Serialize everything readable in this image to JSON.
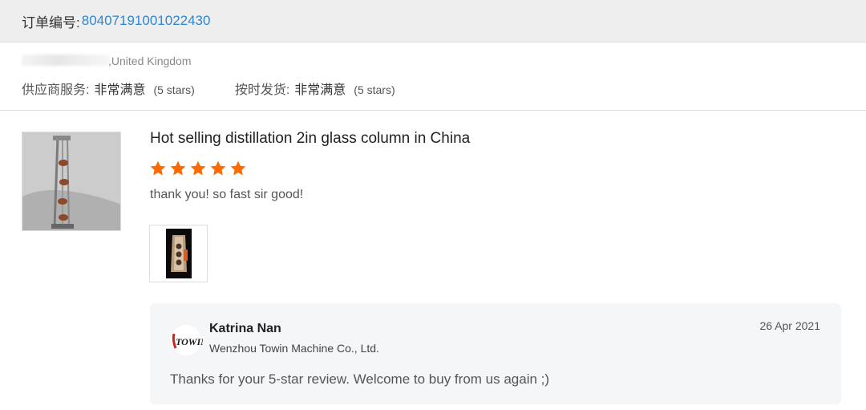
{
  "order": {
    "label": "订单编号:",
    "number": "80407191001022430"
  },
  "buyer": {
    "country": ",United Kingdom"
  },
  "ratings": [
    {
      "label": "供应商服务:",
      "value": "非常满意",
      "stars": "(5 stars)"
    },
    {
      "label": "按时发货:",
      "value": "非常满意",
      "stars": "(5 stars)"
    }
  ],
  "product": {
    "title": "Hot selling distillation 2in glass column in China",
    "rating": 5,
    "review": "thank you! so fast sir good!"
  },
  "reply": {
    "seller_name": "Katrina Nan",
    "company": "Wenzhou Towin Machine Co., Ltd.",
    "date": "26 Apr 2021",
    "text": "Thanks for your 5-star review. Welcome to buy from us again ;)",
    "logo_text": "TOWIN"
  },
  "colors": {
    "link": "#2e86d4",
    "star": "#ff6a00",
    "header_bg": "#eeeeee",
    "reply_bg": "#f5f6f7"
  },
  "icons": {
    "star": "star-icon",
    "logo": "towin-logo"
  }
}
